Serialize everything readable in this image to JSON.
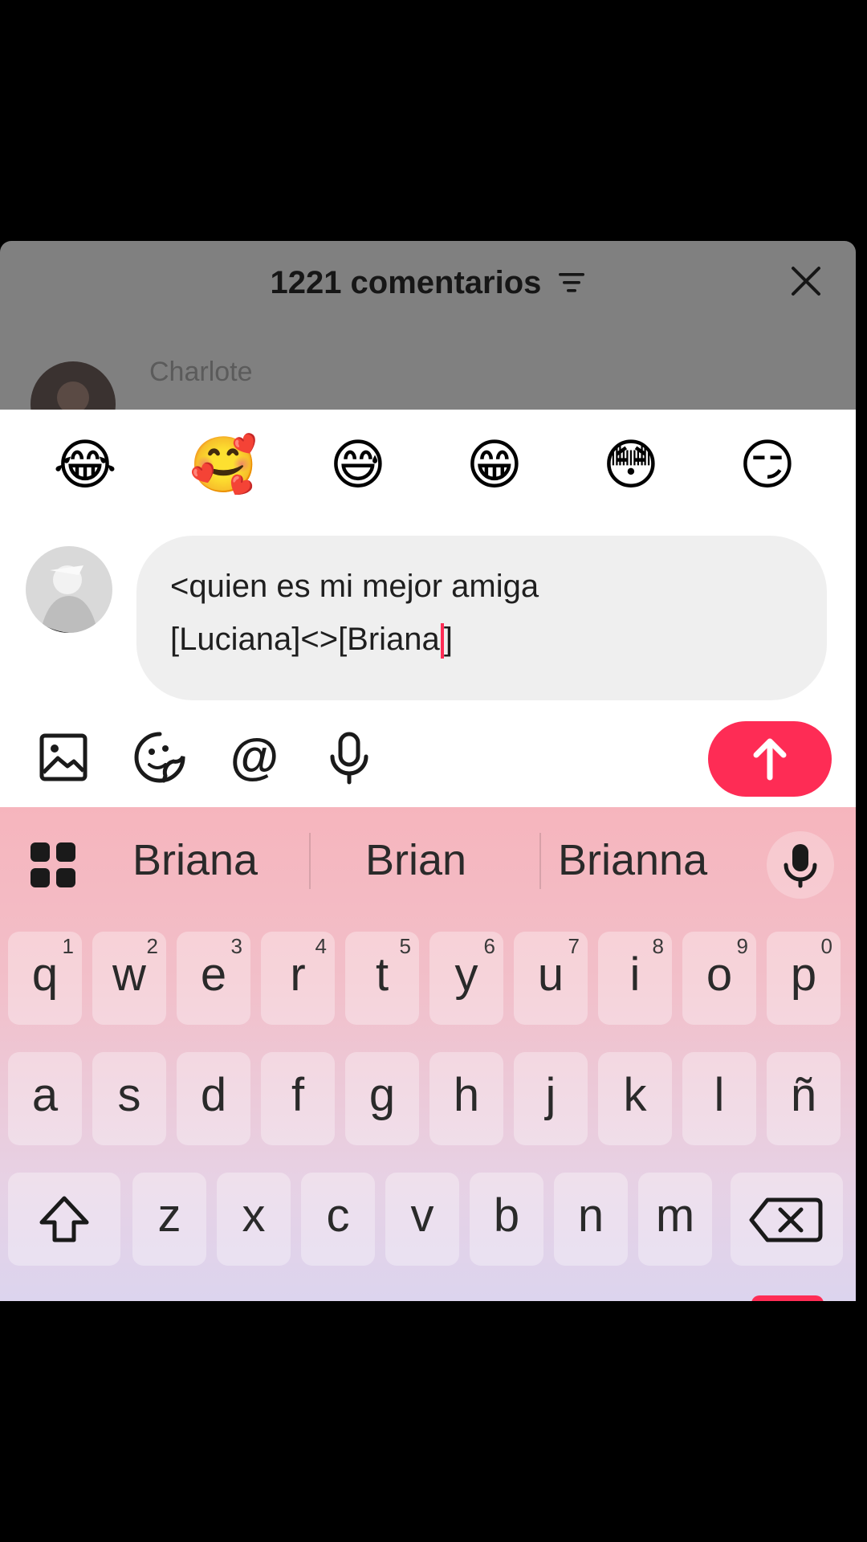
{
  "comments": {
    "title": "1221 comentarios",
    "commenter_name": "Charlote"
  },
  "emoji_bar": [
    "😂",
    "🥰",
    "😅",
    "😁",
    "😳",
    "😏"
  ],
  "compose": {
    "text": "<quien es mi mejor amiga\n[Luciana]<>[Briana",
    "text_after_caret": "]"
  },
  "toolbar": {
    "icons": [
      "image-icon",
      "sticker-icon",
      "mention-icon",
      "microphone-icon"
    ],
    "mention_glyph": "@",
    "send_color": "#fe2c55"
  },
  "keyboard": {
    "suggestions": [
      "Briana",
      "Brian",
      "Brianna"
    ],
    "row1": [
      [
        "q",
        "1"
      ],
      [
        "w",
        "2"
      ],
      [
        "e",
        "3"
      ],
      [
        "r",
        "4"
      ],
      [
        "t",
        "5"
      ],
      [
        "y",
        "6"
      ],
      [
        "u",
        "7"
      ],
      [
        "i",
        "8"
      ],
      [
        "o",
        "9"
      ],
      [
        "p",
        "0"
      ]
    ],
    "row2": [
      "a",
      "s",
      "d",
      "f",
      "g",
      "h",
      "j",
      "k",
      "l",
      "ñ"
    ],
    "row3": [
      "z",
      "x",
      "c",
      "v",
      "b",
      "n",
      "m"
    ]
  },
  "colors": {
    "accent": "#fe2c55",
    "overlay": "#808080"
  }
}
